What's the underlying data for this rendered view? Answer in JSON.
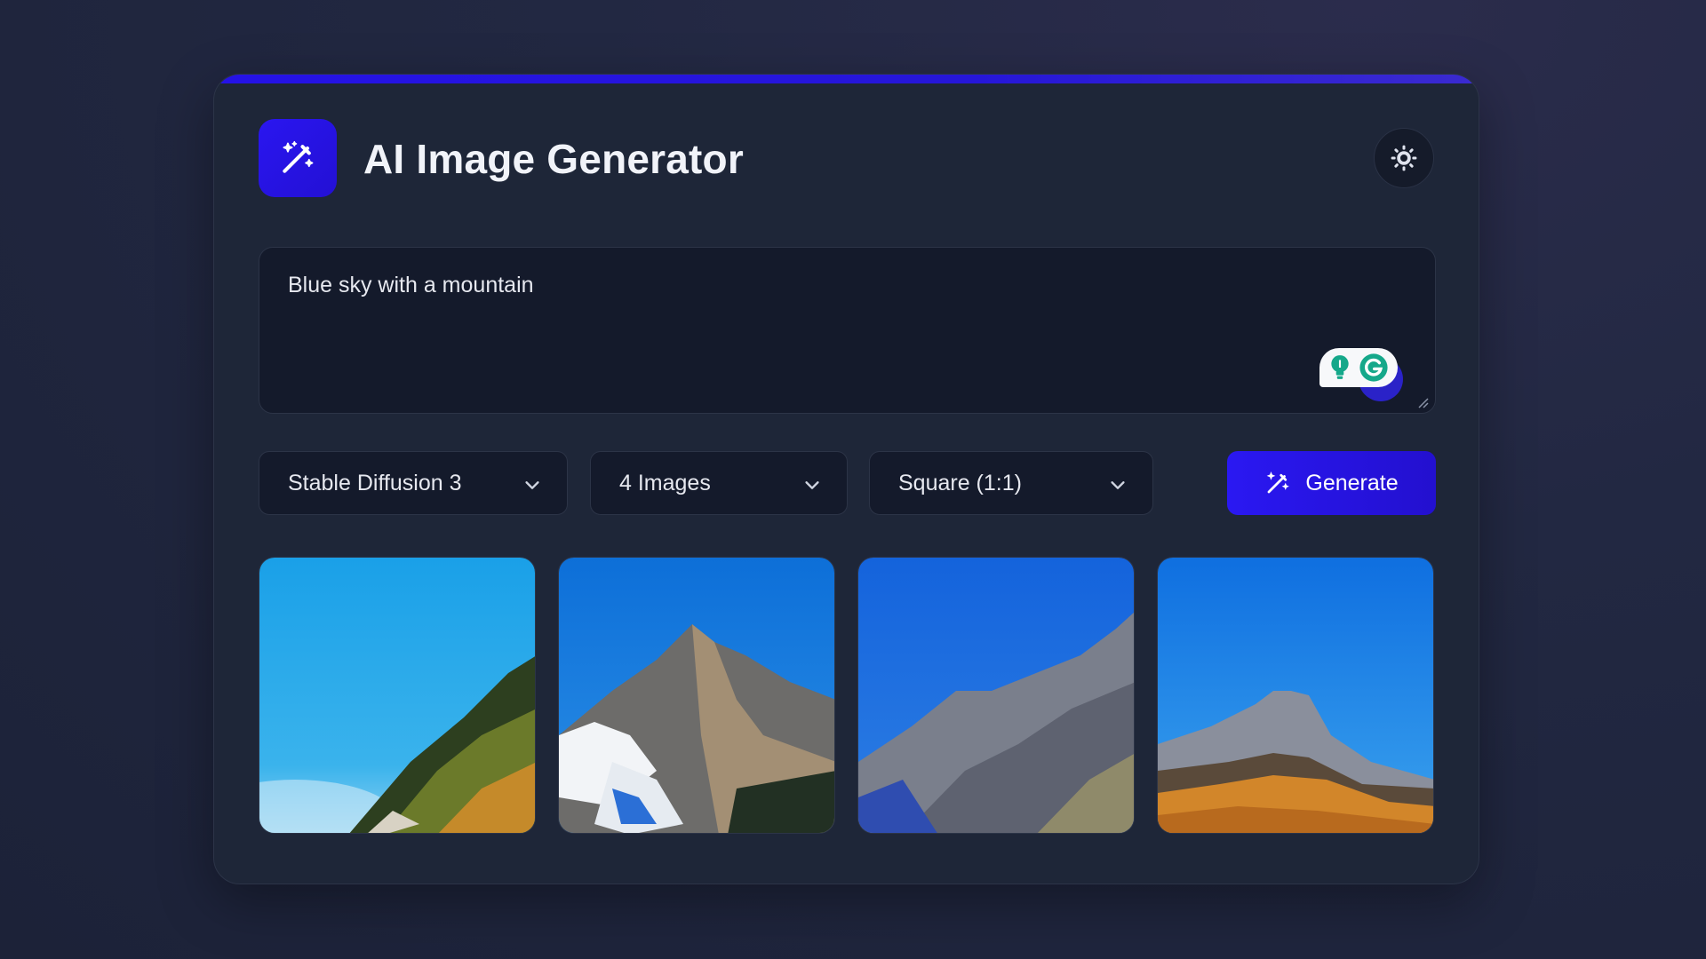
{
  "app": {
    "title": "AI Image Generator",
    "logo_icon": "magic-wand-icon",
    "theme_toggle_icon": "sun-icon"
  },
  "prompt": {
    "value": "Blue sky with a mountain",
    "placeholder": ""
  },
  "controls": {
    "model": {
      "selected": "Stable Diffusion 3"
    },
    "count": {
      "selected": "4 Images"
    },
    "ratio": {
      "selected": "Square (1:1)"
    },
    "generate_label": "Generate"
  },
  "gallery": {
    "images": [
      {
        "description_icon": "mountain-image"
      },
      {
        "description_icon": "mountain-image"
      },
      {
        "description_icon": "mountain-image"
      },
      {
        "description_icon": "mountain-image"
      }
    ]
  },
  "colors": {
    "accent": "#2a16f0",
    "background": "#222842",
    "card": "#1e2638",
    "field": "#141a2b"
  }
}
